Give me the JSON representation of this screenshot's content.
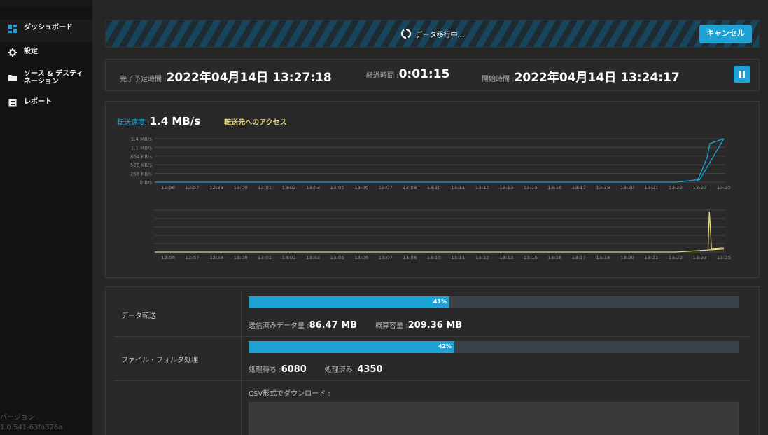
{
  "sidebar": {
    "items": [
      {
        "label": "ダッシュボード",
        "icon": "dashboard-icon"
      },
      {
        "label": "設定",
        "icon": "gear-icon"
      },
      {
        "label_line1": "ソース & デスティ",
        "label_line2": "ネーション",
        "icon": "folder-icon"
      },
      {
        "label": "レポート",
        "icon": "report-icon"
      }
    ],
    "version_label": "バージョン",
    "version_value": "1.0.541-63fa326a"
  },
  "banner": {
    "status": "データ移行中…",
    "cancel_label": "キャンセル"
  },
  "info": {
    "eta_label": "完了予定時間 : ",
    "eta_value": "2022年04月14日 13:27:18",
    "elapsed_label": "経過時間 : ",
    "elapsed_value": "0:01:15",
    "start_label": "開始時間 : ",
    "start_value": "2022年04月14日 13:24:17"
  },
  "speed": {
    "label": "転送速度 : ",
    "value": "1.4 MB/s",
    "access_label": "転送元へのアクセス"
  },
  "chart_data": [
    {
      "type": "line",
      "ylabels": [
        "1.4 MB/s",
        "1.1 MB/s",
        "864 KB/s",
        "576 KB/s",
        "288 KB/s",
        "0 B/s"
      ],
      "x": [
        "12:56",
        "12:57",
        "12:58",
        "13:00",
        "13:01",
        "13:02",
        "13:03",
        "13:05",
        "13:06",
        "13:07",
        "13:08",
        "13:10",
        "13:11",
        "13:12",
        "13:13",
        "13:15",
        "13:16",
        "13:17",
        "13:18",
        "13:20",
        "13:21",
        "13:22",
        "13:23",
        "13:25"
      ],
      "series": [
        {
          "color": "#1fa3d6",
          "values": [
            0,
            0,
            0,
            0,
            0,
            0,
            0,
            0,
            0,
            0,
            0,
            0,
            0,
            0,
            0,
            0,
            0,
            0,
            0,
            0,
            0,
            0,
            0.08,
            1.4
          ]
        }
      ]
    },
    {
      "type": "line",
      "x": [
        "12:56",
        "12:57",
        "12:58",
        "13:00",
        "13:01",
        "13:02",
        "13:03",
        "13:05",
        "13:06",
        "13:07",
        "13:08",
        "13:10",
        "13:11",
        "13:12",
        "13:13",
        "13:15",
        "13:16",
        "13:17",
        "13:18",
        "13:20",
        "13:21",
        "13:22",
        "13:23",
        "13:25"
      ],
      "series": [
        {
          "color": "#e3d87e",
          "values": [
            0,
            0,
            0,
            0,
            0,
            0,
            0,
            0,
            0,
            0,
            0,
            0,
            0,
            0,
            0,
            0,
            0,
            0,
            0,
            0,
            0,
            0,
            0.05,
            0.1
          ]
        }
      ]
    }
  ],
  "progress": {
    "transfer": {
      "label": "データ転送",
      "percent": 41,
      "percent_label": "41%",
      "sent_label": "送信済みデータ量 : ",
      "sent_value": "86.47 MB",
      "total_label": "概算容量 : ",
      "total_value": "209.36 MB"
    },
    "files": {
      "label": "ファイル・フォルダ処理",
      "percent": 42,
      "percent_label": "42%",
      "pending_label": "処理待ち : ",
      "pending_value": "6080",
      "done_label": "処理済み : ",
      "done_value": "4350"
    },
    "csv_label": "CSV形式でダウンロード :"
  },
  "colors": {
    "accent": "#1fa3d6",
    "access_line": "#e3d87e"
  }
}
